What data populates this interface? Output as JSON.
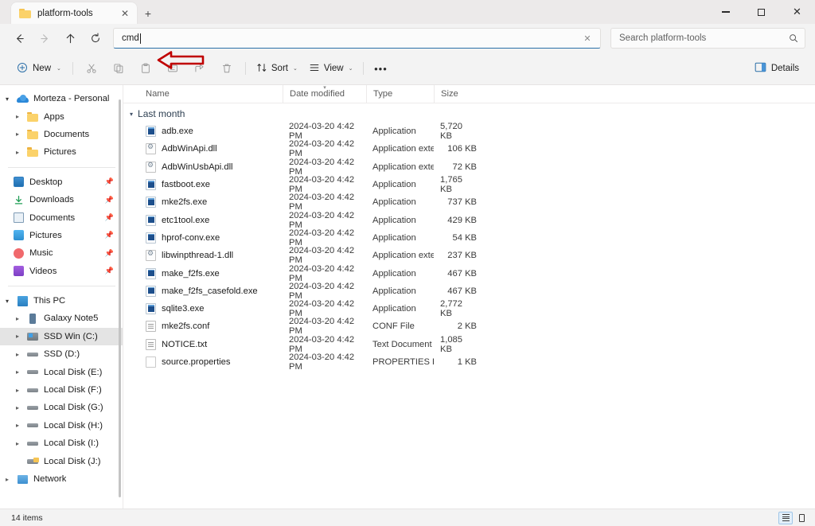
{
  "window": {
    "tab": {
      "title": "platform-tools",
      "icon": "folder-icon",
      "close_label": "✕"
    },
    "new_tab_label": "+",
    "controls": {
      "minimize": "minimize-icon",
      "maximize": "maximize-icon",
      "close": "✕"
    }
  },
  "address": {
    "value": "cmd",
    "clear_label": "✕",
    "back_label": "Back",
    "forward_label": "Forward",
    "up_label": "Up",
    "refresh_label": "Refresh"
  },
  "search": {
    "placeholder": "Search platform-tools",
    "icon": "search-icon"
  },
  "toolbar": {
    "new_label": "New",
    "cut_label": "Cut",
    "copy_label": "Copy",
    "paste_label": "Paste",
    "rename_label": "Rename",
    "share_label": "Share",
    "delete_label": "Delete",
    "sort_label": "Sort",
    "view_label": "View",
    "more_label": "•••",
    "details_label": "Details",
    "chevron": "⌄"
  },
  "sidebar": {
    "sections": [
      {
        "items": [
          {
            "label": "Morteza - Personal",
            "icon": "onedrive-icon",
            "indent": 0,
            "chevron": "open",
            "pinned": false
          },
          {
            "label": "Apps",
            "icon": "folder-icon",
            "indent": 1,
            "chevron": "closed",
            "pinned": false
          },
          {
            "label": "Documents",
            "icon": "folder-icon",
            "indent": 1,
            "chevron": "closed",
            "pinned": false
          },
          {
            "label": "Pictures",
            "icon": "folder-icon",
            "indent": 1,
            "chevron": "closed",
            "pinned": false
          }
        ]
      },
      {
        "items": [
          {
            "label": "Desktop",
            "icon": "desktop-icon",
            "indent": 1,
            "chevron": "none",
            "pinned": true
          },
          {
            "label": "Downloads",
            "icon": "downloads-icon",
            "indent": 1,
            "chevron": "none",
            "pinned": true
          },
          {
            "label": "Documents",
            "icon": "documents-icon",
            "indent": 1,
            "chevron": "none",
            "pinned": true
          },
          {
            "label": "Pictures",
            "icon": "pictures-icon",
            "indent": 1,
            "chevron": "none",
            "pinned": true
          },
          {
            "label": "Music",
            "icon": "music-icon",
            "indent": 1,
            "chevron": "none",
            "pinned": true
          },
          {
            "label": "Videos",
            "icon": "videos-icon",
            "indent": 1,
            "chevron": "none",
            "pinned": true
          }
        ]
      },
      {
        "items": [
          {
            "label": "This PC",
            "icon": "thispc-icon",
            "indent": 0,
            "chevron": "open",
            "pinned": false
          },
          {
            "label": "Galaxy Note5",
            "icon": "phone-icon",
            "indent": 1,
            "chevron": "closed",
            "pinned": false
          },
          {
            "label": "SSD Win (C:)",
            "icon": "windrive-icon",
            "indent": 1,
            "chevron": "closed",
            "pinned": false,
            "selected": true
          },
          {
            "label": "SSD (D:)",
            "icon": "drive-icon",
            "indent": 1,
            "chevron": "closed",
            "pinned": false
          },
          {
            "label": "Local Disk (E:)",
            "icon": "drive-icon",
            "indent": 1,
            "chevron": "closed",
            "pinned": false
          },
          {
            "label": "Local Disk (F:)",
            "icon": "drive-icon",
            "indent": 1,
            "chevron": "closed",
            "pinned": false
          },
          {
            "label": "Local Disk (G:)",
            "icon": "drive-icon",
            "indent": 1,
            "chevron": "closed",
            "pinned": false
          },
          {
            "label": "Local Disk (H:)",
            "icon": "drive-icon",
            "indent": 1,
            "chevron": "closed",
            "pinned": false
          },
          {
            "label": "Local Disk (I:)",
            "icon": "drive-icon",
            "indent": 1,
            "chevron": "closed",
            "pinned": false
          },
          {
            "label": "Local Disk (J:)",
            "icon": "drive-j-icon",
            "indent": 1,
            "chevron": "none",
            "pinned": false
          },
          {
            "label": "Network",
            "icon": "network-icon",
            "indent": 0,
            "chevron": "closed",
            "pinned": false
          }
        ]
      }
    ]
  },
  "filelist": {
    "columns": [
      {
        "label": "Name"
      },
      {
        "label": "Date modified",
        "sorted": true
      },
      {
        "label": "Type"
      },
      {
        "label": "Size"
      }
    ],
    "group_label": "Last month",
    "group_chevron": "⌄",
    "rows": [
      {
        "name": "adb.exe",
        "date": "2024-03-20 4:42 PM",
        "type": "Application",
        "size": "5,720 KB",
        "icon": "exe"
      },
      {
        "name": "AdbWinApi.dll",
        "date": "2024-03-20 4:42 PM",
        "type": "Application exten...",
        "size": "106 KB",
        "icon": "dll"
      },
      {
        "name": "AdbWinUsbApi.dll",
        "date": "2024-03-20 4:42 PM",
        "type": "Application exten...",
        "size": "72 KB",
        "icon": "dll"
      },
      {
        "name": "fastboot.exe",
        "date": "2024-03-20 4:42 PM",
        "type": "Application",
        "size": "1,765 KB",
        "icon": "exe"
      },
      {
        "name": "mke2fs.exe",
        "date": "2024-03-20 4:42 PM",
        "type": "Application",
        "size": "737 KB",
        "icon": "exe"
      },
      {
        "name": "etc1tool.exe",
        "date": "2024-03-20 4:42 PM",
        "type": "Application",
        "size": "429 KB",
        "icon": "exe"
      },
      {
        "name": "hprof-conv.exe",
        "date": "2024-03-20 4:42 PM",
        "type": "Application",
        "size": "54 KB",
        "icon": "exe"
      },
      {
        "name": "libwinpthread-1.dll",
        "date": "2024-03-20 4:42 PM",
        "type": "Application exten...",
        "size": "237 KB",
        "icon": "dll"
      },
      {
        "name": "make_f2fs.exe",
        "date": "2024-03-20 4:42 PM",
        "type": "Application",
        "size": "467 KB",
        "icon": "exe"
      },
      {
        "name": "make_f2fs_casefold.exe",
        "date": "2024-03-20 4:42 PM",
        "type": "Application",
        "size": "467 KB",
        "icon": "exe"
      },
      {
        "name": "sqlite3.exe",
        "date": "2024-03-20 4:42 PM",
        "type": "Application",
        "size": "2,772 KB",
        "icon": "exe"
      },
      {
        "name": "mke2fs.conf",
        "date": "2024-03-20 4:42 PM",
        "type": "CONF File",
        "size": "2 KB",
        "icon": "doc"
      },
      {
        "name": "NOTICE.txt",
        "date": "2024-03-20 4:42 PM",
        "type": "Text Document",
        "size": "1,085 KB",
        "icon": "doc"
      },
      {
        "name": "source.properties",
        "date": "2024-03-20 4:42 PM",
        "type": "PROPERTIES File",
        "size": "1 KB",
        "icon": "blank"
      }
    ]
  },
  "statusbar": {
    "item_count": "14 items",
    "details_view_label": "Details view",
    "tiles_view_label": "Large icons view"
  },
  "annotation": {
    "arrow": "red-left-arrow",
    "color": "#c00000"
  }
}
